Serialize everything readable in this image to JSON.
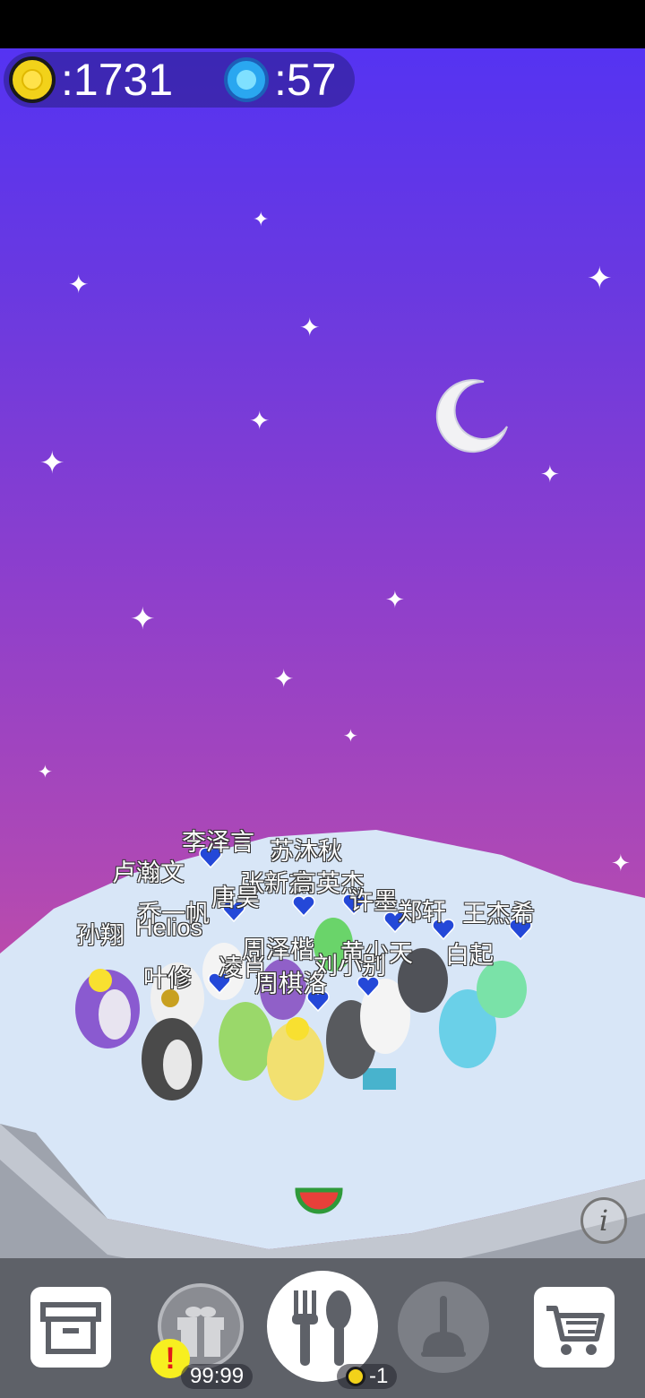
{
  "hud": {
    "coins": ":1731",
    "gems": ":57"
  },
  "player_names": [
    "李泽言",
    "苏沐秋",
    "卢瀚文",
    "张新杰",
    "高英杰",
    "唐昊",
    "许墨",
    "郑轩",
    "王杰希",
    "乔一帆",
    "孙翔",
    "Helios",
    "周泽楷",
    "黄少天",
    "刘小别",
    "白起",
    "叶修",
    "凌肖",
    "周棋洛"
  ],
  "bottom_bar": {
    "gift_timer": "99:99",
    "feed_cost": "-1",
    "alert_glyph": "!"
  },
  "info_glyph": "i",
  "colors": {
    "sky_top": "#5533f2",
    "sky_bottom": "#dd4f8a",
    "ice": "#d8e6f7",
    "bar": "#5e6168",
    "heart": "#2448d8"
  }
}
